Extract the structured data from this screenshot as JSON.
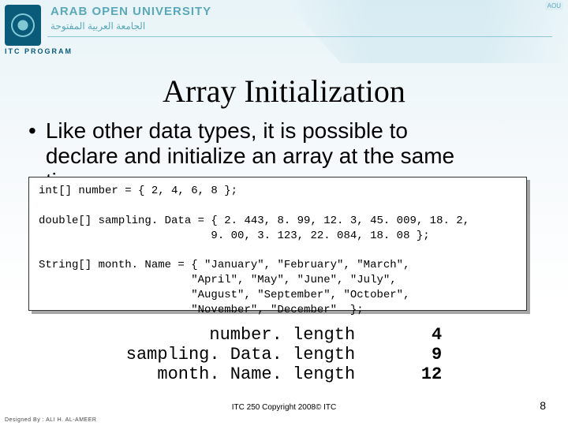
{
  "header": {
    "univ_en": "ARAB OPEN UNIVERSITY",
    "univ_ar": "الجامعة العربية المفتوحة",
    "itc": "ITC PROGRAM",
    "badge": "AOU"
  },
  "title": "Array Initialization",
  "body": {
    "line1": "Like other data types, it is possible to",
    "line2": "declare and initialize an array at the same",
    "line3": "ti"
  },
  "code": "int[] number = { 2, 4, 6, 8 };\n\ndouble[] sampling. Data = { 2. 443, 8. 99, 12. 3, 45. 009, 18. 2,\n                          9. 00, 3. 123, 22. 084, 18. 08 };\n\nString[] month. Name = { \"January\", \"February\", \"March\",\n                       \"April\", \"May\", \"June\", \"July\",\n                       \"August\", \"September\", \"October\",\n                       \"November\", \"December\"  };",
  "lengths": {
    "l1_label": "number. length",
    "l1_value": "4",
    "l2_label": "sampling. Data. length",
    "l2_value": "9",
    "l3_label": "month. Name. length",
    "l3_value": "12"
  },
  "footer": {
    "copyright": "ITC 250 Copyright 2008© ITC",
    "page": "8",
    "designed": "Designed By : ALI H. AL-AMEER"
  }
}
